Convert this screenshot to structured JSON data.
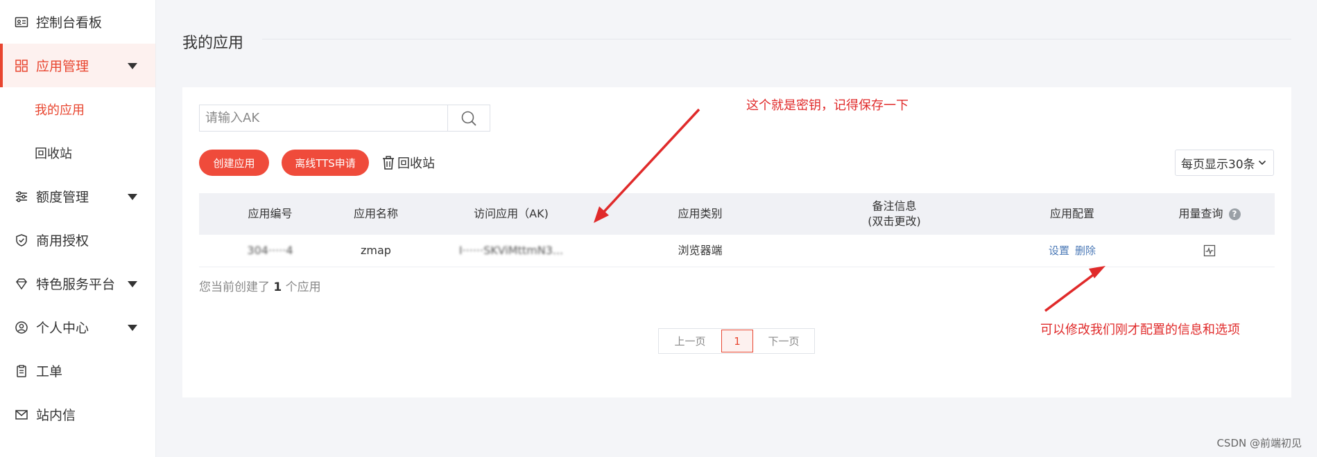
{
  "sidebar": {
    "items": [
      {
        "label": "控制台看板",
        "icon": "id-card-icon",
        "active": false,
        "has_caret": false
      },
      {
        "label": "应用管理",
        "icon": "grid-icon",
        "active": true,
        "has_caret": true
      },
      {
        "label": "额度管理",
        "icon": "sliders-icon",
        "active": false,
        "has_caret": true
      },
      {
        "label": "商用授权",
        "icon": "shield-check-icon",
        "active": false,
        "has_caret": false
      },
      {
        "label": "特色服务平台",
        "icon": "diamond-icon",
        "active": false,
        "has_caret": true
      },
      {
        "label": "个人中心",
        "icon": "user-circle-icon",
        "active": false,
        "has_caret": true
      },
      {
        "label": "工单",
        "icon": "clipboard-icon",
        "active": false,
        "has_caret": false
      },
      {
        "label": "站内信",
        "icon": "mail-icon",
        "active": false,
        "has_caret": false
      }
    ],
    "sub_items": [
      {
        "label": "我的应用",
        "current": true
      },
      {
        "label": "回收站",
        "current": false
      }
    ]
  },
  "page": {
    "title": "我的应用"
  },
  "toolbar": {
    "search_placeholder": "请输入AK",
    "create_label": "创建应用",
    "tts_label": "离线TTS申请",
    "recycle_label": "回收站",
    "page_size_label": "每页显示30条"
  },
  "table": {
    "headers": {
      "id": "应用编号",
      "name": "应用名称",
      "ak": "访问应用（AK)",
      "type": "应用类别",
      "remark_line1": "备注信息",
      "remark_line2": "(双击更改)",
      "config": "应用配置",
      "usage": "用量查询"
    },
    "rows": [
      {
        "id": "304·····4",
        "name": "zmap",
        "ak": "I······SKViMttmN3...",
        "type": "浏览器端",
        "remark": "",
        "config_set": "设置",
        "config_delete": "删除"
      }
    ]
  },
  "summary": {
    "prefix": "您当前创建了",
    "count": "1",
    "suffix": "个应用"
  },
  "pagination": {
    "prev": "上一页",
    "current": "1",
    "next": "下一页"
  },
  "annotations": {
    "ak_note": "这个就是密钥，记得保存一下",
    "config_note": "可以修改我们刚才配置的信息和选项",
    "color": "#e02a2a"
  },
  "watermark": "CSDN @前端初见",
  "colors": {
    "accent": "#e8452f",
    "button": "#ef4b3b",
    "link": "#4a78b6"
  }
}
